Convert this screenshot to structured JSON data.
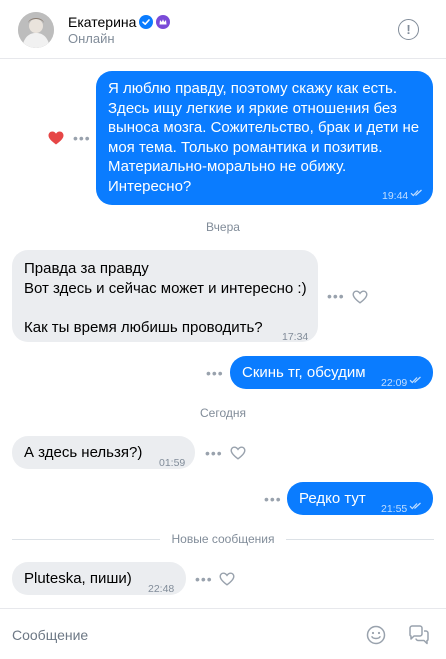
{
  "header": {
    "name": "Екатерина",
    "status": "Онлайн",
    "info_icon_glyph": "!",
    "verified_color": "#0a7cff",
    "premium_color": "#7a4bd8"
  },
  "messages": [
    {
      "direction": "out",
      "text": "Я люблю правду, поэтому скажу как есть. Здесь ищу легкие и яркие отношения без выноса мозга. Сожительство, брак и дети не моя тема. Только романтика и позитив. Материально-морально не обижу. Интересно?",
      "time": "19:44",
      "read": true,
      "liked": true
    },
    {
      "direction": "divider",
      "text": "Вчера"
    },
    {
      "direction": "in",
      "text": "Правда за правду\nВот здесь и сейчас может и интересно :)\n\nКак ты время любишь проводить?",
      "time": "17:34"
    },
    {
      "direction": "out",
      "text": "Скинь тг, обсудим",
      "time": "22:09",
      "read": true
    },
    {
      "direction": "divider",
      "text": "Сегодня"
    },
    {
      "direction": "in",
      "text": "А здесь нельзя?)",
      "time": "01:59"
    },
    {
      "direction": "out",
      "text": "Редко тут",
      "time": "21:55",
      "read": true
    },
    {
      "direction": "divider",
      "text": "Новые сообщения"
    },
    {
      "direction": "in",
      "text": "Pluteska, пиши)",
      "time": "22:48"
    }
  ],
  "footer": {
    "placeholder": "Сообщение"
  },
  "colors": {
    "outgoing_bubble": "#0a7cff",
    "incoming_bubble": "#ebedf0",
    "like_heart": "#e64646",
    "muted_text": "#818c99"
  }
}
